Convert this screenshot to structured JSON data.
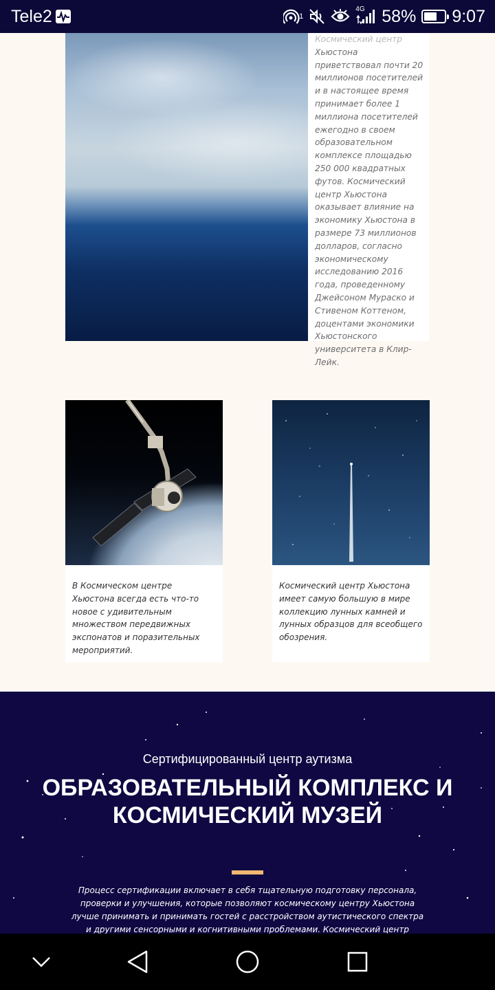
{
  "status_bar": {
    "carrier": "Tele2",
    "network": "4G",
    "battery": "58%",
    "time": "9:07",
    "hotspot_badge": "1",
    "icons": [
      "activity-icon",
      "hotspot-icon",
      "mute-icon",
      "eye-icon",
      "signal-icon",
      "battery-icon"
    ]
  },
  "feature": {
    "text_faded": "Космический центр",
    "text": "Хьюстона приветствовал почти 20 миллионов посетителей и в настоящее время принимает более 1 миллиона посетителей ежегодно в своем образовательном комплексе площадью 250 000 квадратных футов. Космический центр Хьюстона оказывает влияние на экономику Хьюстона в размере 73 миллионов долларов, согласно экономическому исследованию 2016 года, проведенному Джейсоном Мураско и Стивеном Коттеном, доцентами экономики Хьюстонского университета в Клир-Лейк."
  },
  "cards": [
    {
      "text": "В Космическом центре Хьюстона всегда есть что-то новое с удивительным множеством передвижных экспонатов и поразительных мероприятий."
    },
    {
      "text": "Космический центр Хьюстона имеет самую большую в мире коллекцию лунных камней и лунных образцов для всеобщего обозрения."
    }
  ],
  "autism_section": {
    "subtitle": "Сертифицированный центр аутизма",
    "title": "ОБРАЗОВАТЕЛЬНЫЙ КОМПЛЕКС И КОСМИЧЕСКИЙ МУЗЕЙ",
    "text": "Процесс сертификации включает в себя тщательную подготовку персонала, проверки и улучшения, которые позволяют космическому центру Хьюстона лучше принимать и принимать гостей с расстройством аутистического спектра и другими сенсорными и когнитивными проблемами. Космический центр Хьюстона всегда приветствовал гостей"
  },
  "colors": {
    "status_bg": "#0c0838",
    "section_bg": "#0f0842",
    "accent": "#f2b872",
    "page_bg": "#fdf8f2"
  },
  "nav_bar": {
    "icons": [
      "chevron-down-icon",
      "back-icon",
      "home-icon",
      "recents-icon"
    ]
  }
}
